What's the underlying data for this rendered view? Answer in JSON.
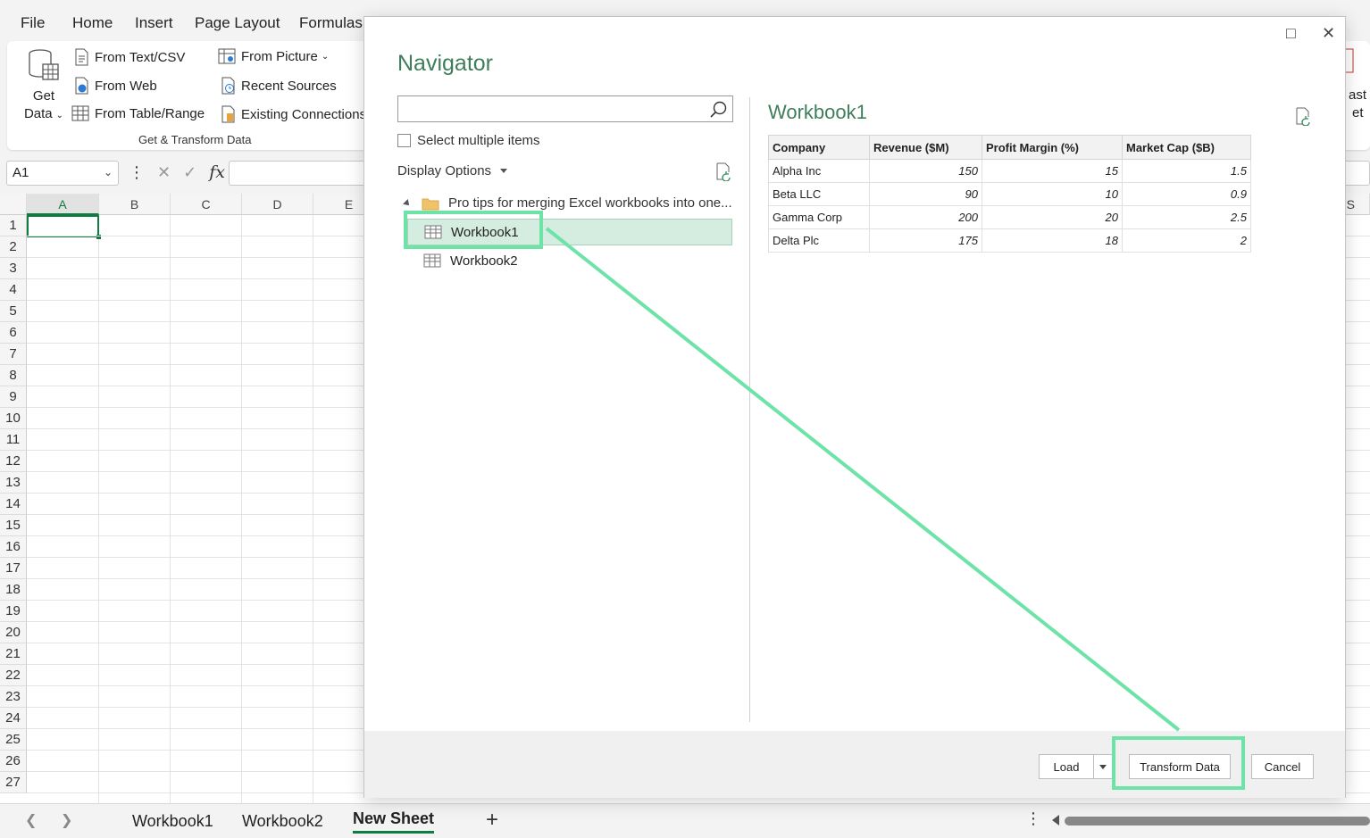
{
  "menu": [
    "File",
    "Home",
    "Insert",
    "Page Layout",
    "Formulas"
  ],
  "ribbon": {
    "get_data_line1": "Get",
    "get_data_line2": "Data",
    "from_text_csv": "From Text/CSV",
    "from_web": "From Web",
    "from_table_range": "From Table/Range",
    "from_picture": "From Picture",
    "recent_sources": "Recent Sources",
    "existing_connections": "Existing Connections",
    "group_label": "Get & Transform Data",
    "right_cut_1": "ast",
    "right_cut_2": "et"
  },
  "formula_bar": {
    "name_box": "A1",
    "fx": "fx",
    "value": ""
  },
  "grid": {
    "columns": [
      "A",
      "B",
      "C",
      "D",
      "E"
    ],
    "far_column": "S",
    "rows": [
      "1",
      "2",
      "3",
      "4",
      "5",
      "6",
      "7",
      "8",
      "9",
      "10",
      "11",
      "12",
      "13",
      "14",
      "15",
      "16",
      "17",
      "18",
      "19",
      "20",
      "21",
      "22",
      "23",
      "24",
      "25",
      "26",
      "27"
    ]
  },
  "sheets": {
    "tabs": [
      "Workbook1",
      "Workbook2",
      "New Sheet"
    ],
    "active": "New Sheet"
  },
  "navigator": {
    "title": "Navigator",
    "search_value": "",
    "select_multiple": "Select multiple items",
    "display_options": "Display Options",
    "folder": "Pro tips for merging Excel workbooks into one...",
    "items": [
      "Workbook1",
      "Workbook2"
    ],
    "selected": "Workbook1",
    "preview": {
      "title": "Workbook1",
      "headers": [
        "Company",
        "Revenue ($M)",
        "Profit Margin (%)",
        "Market Cap ($B)"
      ],
      "rows": [
        [
          "Alpha Inc",
          "150",
          "15",
          "1.5"
        ],
        [
          "Beta LLC",
          "90",
          "10",
          "0.9"
        ],
        [
          "Gamma Corp",
          "200",
          "20",
          "2.5"
        ],
        [
          "Delta Plc",
          "175",
          "18",
          "2"
        ]
      ]
    },
    "buttons": {
      "load": "Load",
      "transform": "Transform Data",
      "cancel": "Cancel"
    }
  },
  "colors": {
    "accent_green": "#107c41",
    "title_green": "#3f7e5a",
    "highlight": "#6ee3a8",
    "selection_bg": "#d5ede0"
  }
}
